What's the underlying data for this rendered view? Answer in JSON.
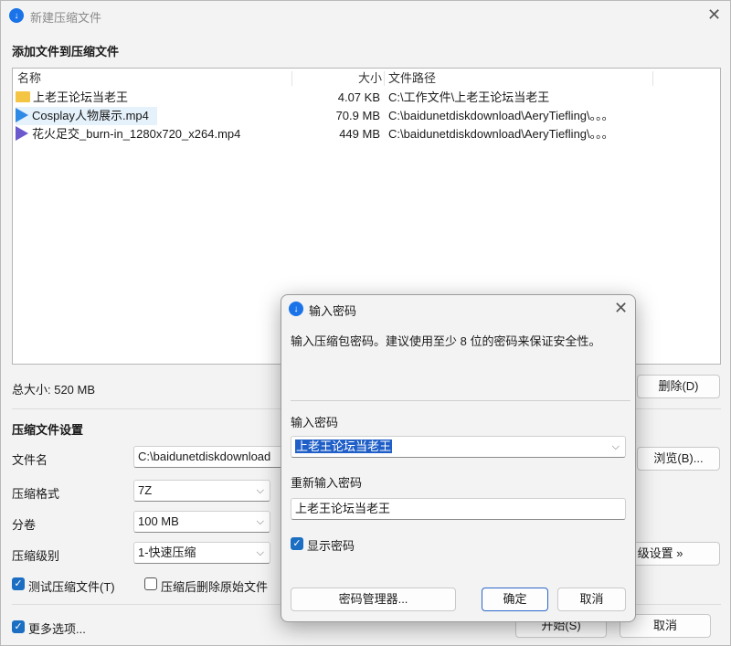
{
  "main": {
    "title": "新建压缩文件",
    "add_section": "添加文件到压缩文件",
    "columns": {
      "name": "名称",
      "size": "大小",
      "path": "文件路径"
    },
    "files": [
      {
        "name": "上老王论坛当老王",
        "size": "4.07 KB",
        "path": "C:\\工作文件\\上老王论坛当老王",
        "icon": "folder-icon"
      },
      {
        "name": "Cosplay人物展示.mp4",
        "size": "70.9 MB",
        "path": "C:\\baidunetdiskdownload\\AeryTiefling\\。。。",
        "icon": "video-icon"
      },
      {
        "name": "花火足交_burn-in_1280x720_x264.mp4",
        "size": "449 MB",
        "path": "C:\\baidunetdiskdownload\\AeryTiefling\\。。。",
        "icon": "video-icon"
      }
    ],
    "total_size": "总大小: 520 MB",
    "delete_button": "删除(D)",
    "settings_section": "压缩文件设置",
    "filename_label": "文件名",
    "filename_value": "C:\\baidunetdiskdownload",
    "browse_button": "浏览(B)...",
    "format_label": "压缩格式",
    "format_value": "7Z",
    "volume_label": "分卷",
    "volume_value": "100 MB",
    "level_label": "压缩级别",
    "level_value": "1-快速压缩",
    "advanced_button": "级设置 »",
    "test_label": "测试压缩文件(T)",
    "delete_after_label": "压缩后删除原始文件",
    "more_options_label": "更多选项...",
    "start_button": "开始(S)",
    "cancel_button": "取消"
  },
  "dialog": {
    "title": "输入密码",
    "description": "输入压缩包密码。建议使用至少 8 位的密码来保证安全性。",
    "password_label": "输入密码",
    "password_value": "上老王论坛当老王",
    "confirm_label": "重新输入密码",
    "confirm_value": "上老王论坛当老王",
    "show_password_label": "显示密码",
    "manager_button": "密码管理器...",
    "ok_button": "确定",
    "cancel_button": "取消"
  },
  "colors": {
    "accent": "#1b6ec2",
    "selection": "#1f5fc7",
    "folder": "#f4c542"
  }
}
